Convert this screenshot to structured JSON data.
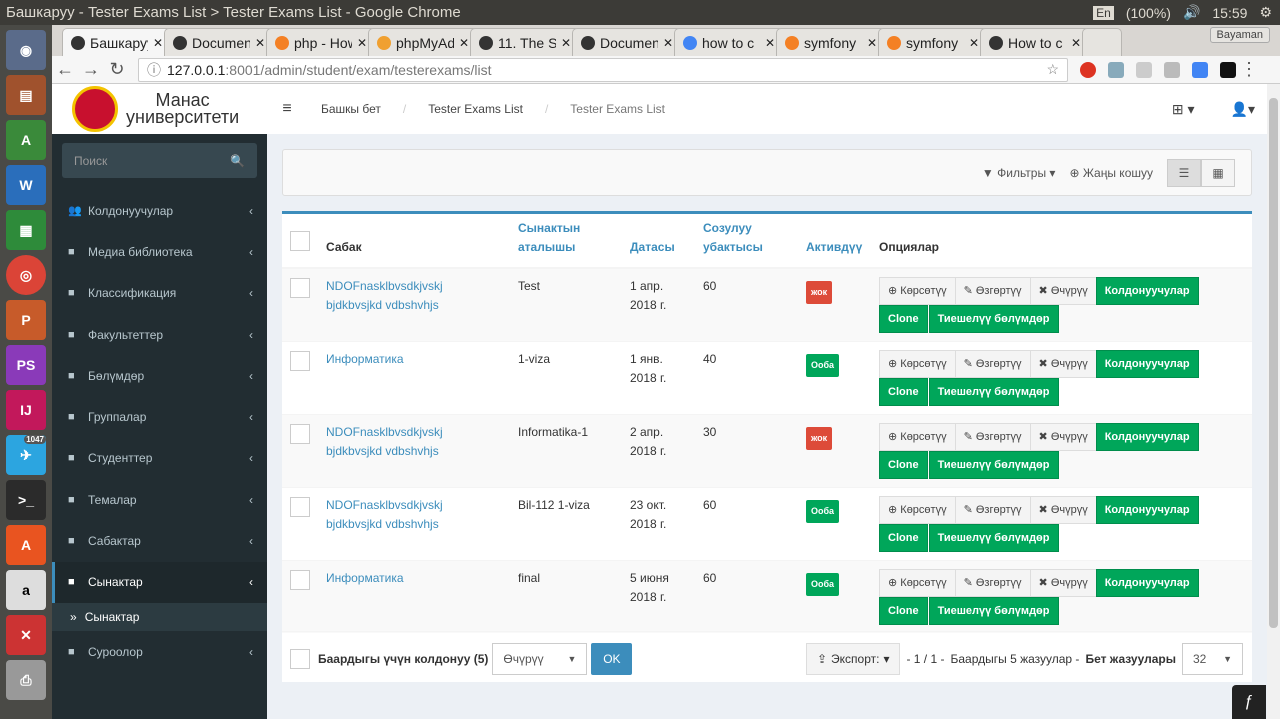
{
  "os": {
    "window_title": "Башкаруу - Tester Exams List > Tester Exams List - Google Chrome",
    "keyboard": "En",
    "battery": "(100%)",
    "clock": "15:59",
    "telegram_badge": "1047"
  },
  "browser": {
    "tabs": [
      "Башкаруу",
      "Documentation",
      "php - How",
      "phpMyAdmin",
      "11. The S",
      "Documentation",
      "how to c",
      "symfony",
      "symfony",
      "How to c"
    ],
    "profile": "Bayaman",
    "url_host": "127.0.0.1",
    "url_rest": ":8001/admin/student/exam/testerexams/list"
  },
  "brand": {
    "line1": "Манас",
    "line2": "университети"
  },
  "breadcrumb": [
    "Башкы бет",
    "Tester Exams List",
    "Tester Exams List"
  ],
  "sidebar": {
    "search_placeholder": "Поиск",
    "items": [
      "Колдонуучулар",
      "Медиа библиотека",
      "Классификация",
      "Факультеттер",
      "Бөлүмдөр",
      "Группалар",
      "Студенттер",
      "Темалар",
      "Сабактар",
      "Сынактар"
    ],
    "sub_item": "Сынактар",
    "last_item": "Суроолор"
  },
  "toolbar": {
    "filters": "Фильтры",
    "add_new": "Жаңы кошуу"
  },
  "table": {
    "headers": [
      "Сабак",
      "Сынактын аталышы",
      "Датасы",
      "Созулуу убактысы",
      "Активдүү",
      "Опциялар"
    ],
    "rows": [
      {
        "subject": "NDOFnasklbvsdkjvskj bjdkbvsjkd vdbshvhjs",
        "name": "Test",
        "date": "1 апр. 2018 г.",
        "duration": "60",
        "active": "жок"
      },
      {
        "subject": "Информатика",
        "name": "1-viza",
        "date": "1 янв. 2018 г.",
        "duration": "40",
        "active": "Ооба"
      },
      {
        "subject": "NDOFnasklbvsdkjvskj bjdkbvsjkd vdbshvhjs",
        "name": "Informatika-1",
        "date": "2 апр. 2018 г.",
        "duration": "30",
        "active": "жок"
      },
      {
        "subject": "NDOFnasklbvsdkjvskj bjdkbvsjkd vdbshvhjs",
        "name": "Bil-112 1-viza",
        "date": "23 окт. 2018 г.",
        "duration": "60",
        "active": "Ооба"
      },
      {
        "subject": "Информатика",
        "name": "final",
        "date": "5 июня 2018 г.",
        "duration": "60",
        "active": "Ооба"
      }
    ],
    "actions": {
      "show": "Көрсөтүү",
      "edit": "Өзгөртүү",
      "delete": "Өчүрүү",
      "users": "Колдонуучулар",
      "clone": "Clone",
      "sections": "Тиешелүү бөлүмдөр"
    }
  },
  "footer": {
    "apply_all": "Баардыгы үчүн колдонуу (5)",
    "batch_action": "Өчүрүү",
    "ok": "OK",
    "export": "Экспорт:",
    "pages": "- 1 / 1 -",
    "total": "Баардыгы 5 жазуулар -",
    "per_page_label": "Бет жазуулары",
    "per_page": "32"
  },
  "colors": {
    "green": "#00a65a",
    "red": "#dd4b39",
    "blue": "#3c8dbc",
    "sidebar": "#222d32"
  }
}
